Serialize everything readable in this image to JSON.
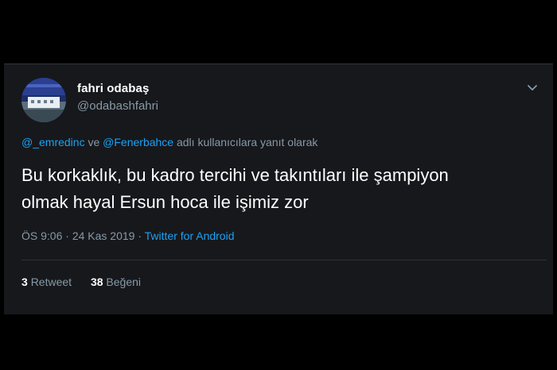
{
  "user": {
    "name": "fahri odabaş",
    "handle": "@odabashfahri",
    "avatar_icon": "profile-photo"
  },
  "reply": {
    "mention1": "@_emredinc",
    "connector": "ve",
    "mention2": "@Fenerbahce",
    "suffix": "adlı kullanıcılara yanıt olarak"
  },
  "tweet": {
    "line1": "Bu korkaklık, bu kadro tercihi ve takıntıları ile şampiyon",
    "line2": "olmak hayal Ersun hoca ile işimiz zor"
  },
  "meta": {
    "time": "ÖS 9:06",
    "separator": "·",
    "date": "24 Kas 2019",
    "source": "Twitter for Android"
  },
  "stats": {
    "retweet_count": "3",
    "retweet_label": "Retweet",
    "like_count": "38",
    "like_label": "Beğeni"
  },
  "colors": {
    "background": "#000000",
    "card": "#16181c",
    "link": "#1da1f2",
    "muted": "#8899a6",
    "text": "#ffffff"
  }
}
